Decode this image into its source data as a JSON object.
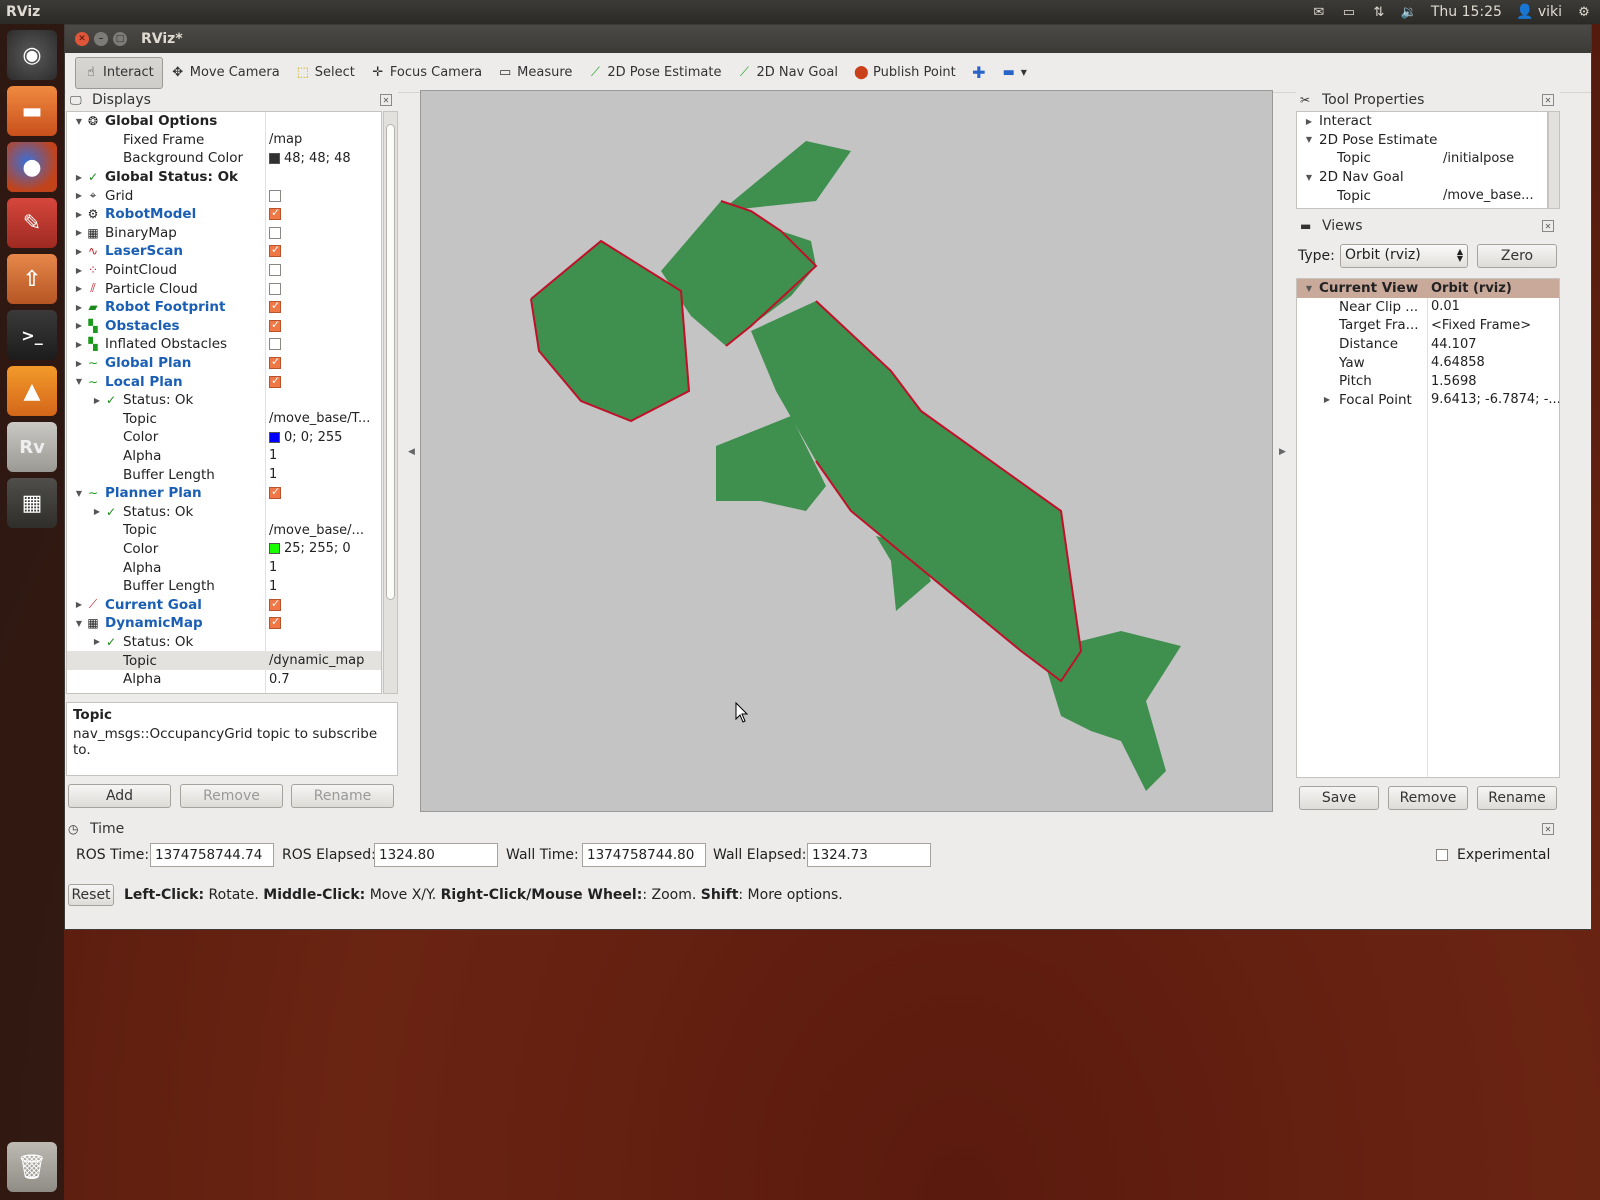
{
  "top_panel": {
    "app_name": "RViz",
    "clock": "Thu 15:25",
    "user": "viki"
  },
  "window": {
    "title": "RViz*"
  },
  "toolbar": {
    "tools": [
      {
        "label": "Interact",
        "icon": "hand-icon"
      },
      {
        "label": "Move Camera",
        "icon": "move-camera-icon"
      },
      {
        "label": "Select",
        "icon": "select-icon"
      },
      {
        "label": "Focus Camera",
        "icon": "focus-camera-icon"
      },
      {
        "label": "Measure",
        "icon": "ruler-icon"
      },
      {
        "label": "2D Pose Estimate",
        "icon": "pose-arrow-icon"
      },
      {
        "label": "2D Nav Goal",
        "icon": "nav-arrow-icon"
      },
      {
        "label": "Publish Point",
        "icon": "map-pin-icon"
      }
    ]
  },
  "displays": {
    "title": "Displays",
    "rows": [
      {
        "name": "Global Options"
      },
      {
        "name": "Fixed Frame",
        "value": "/map"
      },
      {
        "name": "Background Color",
        "value": "48; 48; 48",
        "color": "#303030"
      },
      {
        "name": "Global Status: Ok"
      },
      {
        "name": "Grid",
        "checked": false
      },
      {
        "name": "RobotModel",
        "checked": true
      },
      {
        "name": "BinaryMap",
        "checked": false
      },
      {
        "name": "LaserScan",
        "checked": true
      },
      {
        "name": "PointCloud",
        "checked": false
      },
      {
        "name": "Particle Cloud",
        "checked": false
      },
      {
        "name": "Robot Footprint",
        "checked": true
      },
      {
        "name": "Obstacles",
        "checked": true
      },
      {
        "name": "Inflated Obstacles",
        "checked": false
      },
      {
        "name": "Global Plan",
        "checked": true
      },
      {
        "name": "Local Plan",
        "checked": true
      },
      {
        "name": "Status: Ok"
      },
      {
        "name": "Topic",
        "value": "/move_base/T..."
      },
      {
        "name": "Color",
        "value": "0; 0; 255",
        "color": "#0000ff"
      },
      {
        "name": "Alpha",
        "value": "1"
      },
      {
        "name": "Buffer Length",
        "value": "1"
      },
      {
        "name": "Planner Plan",
        "checked": true
      },
      {
        "name": "Status: Ok"
      },
      {
        "name": "Topic",
        "value": "/move_base/..."
      },
      {
        "name": "Color",
        "value": "25; 255; 0",
        "color": "#19ff00"
      },
      {
        "name": "Alpha",
        "value": "1"
      },
      {
        "name": "Buffer Length",
        "value": "1"
      },
      {
        "name": "Current Goal",
        "checked": true
      },
      {
        "name": "DynamicMap",
        "checked": true
      },
      {
        "name": "Status: Ok"
      },
      {
        "name": "Topic",
        "value": "/dynamic_map"
      },
      {
        "name": "Alpha",
        "value": "0.7"
      }
    ],
    "description": {
      "title": "Topic",
      "text": "nav_msgs::OccupancyGrid topic to subscribe to."
    },
    "buttons": {
      "add": "Add",
      "remove": "Remove",
      "rename": "Rename"
    }
  },
  "tool_properties": {
    "title": "Tool Properties",
    "rows": [
      {
        "name": "Interact"
      },
      {
        "name": "2D Pose Estimate"
      },
      {
        "name": "Topic",
        "value": "/initialpose"
      },
      {
        "name": "2D Nav Goal"
      },
      {
        "name": "Topic",
        "value": "/move_base..."
      }
    ]
  },
  "views": {
    "title": "Views",
    "type_label": "Type:",
    "type_value": "Orbit (rviz)",
    "zero_label": "Zero",
    "header": {
      "name": "Current View",
      "value": "Orbit (rviz)"
    },
    "rows": [
      {
        "name": "Near Clip ...",
        "value": "0.01"
      },
      {
        "name": "Target Fra...",
        "value": "<Fixed Frame>"
      },
      {
        "name": "Distance",
        "value": "44.107"
      },
      {
        "name": "Yaw",
        "value": "4.64858"
      },
      {
        "name": "Pitch",
        "value": "1.5698"
      },
      {
        "name": "Focal Point",
        "value": "9.6413; -6.7874; -..."
      }
    ],
    "buttons": {
      "save": "Save",
      "remove": "Remove",
      "rename": "Rename"
    }
  },
  "time": {
    "title": "Time",
    "ros_time_label": "ROS Time:",
    "ros_time": "1374758744.74",
    "ros_elapsed_label": "ROS Elapsed:",
    "ros_elapsed": "1324.80",
    "wall_time_label": "Wall Time:",
    "wall_time": "1374758744.80",
    "wall_elapsed_label": "Wall Elapsed:",
    "wall_elapsed": "1324.73",
    "experimental_label": "Experimental"
  },
  "status": {
    "reset": "Reset",
    "k1": "Left-Click:",
    "v1": " Rotate. ",
    "k2": "Middle-Click:",
    "v2": " Move X/Y. ",
    "k3": "Right-Click/Mouse Wheel:",
    "v3": ": Zoom. ",
    "k4": "Shift",
    "v4": ": More options."
  },
  "map_colors": {
    "free": "#3f8f4f",
    "background": "#c4c4c4",
    "edge": "#c0102a"
  }
}
